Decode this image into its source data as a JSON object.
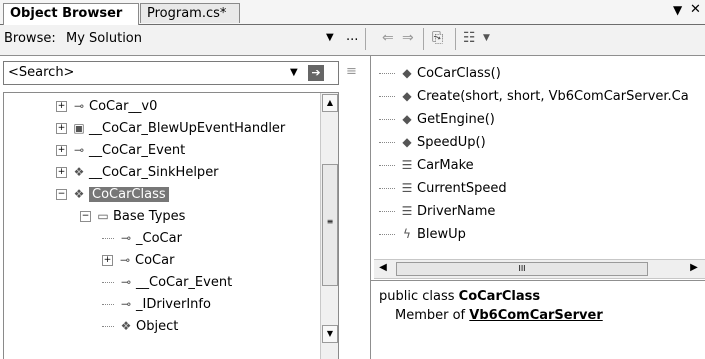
{
  "tabs": [
    {
      "label": "Object Browser",
      "active": true
    },
    {
      "label": "Program.cs*",
      "active": false
    }
  ],
  "tab_controls": {
    "menu_icon": "dropdown-arrow-icon",
    "close_icon": "close-icon"
  },
  "browse": {
    "label": "Browse:",
    "value": "My Solution",
    "more_label": "..."
  },
  "toolbar_icons": [
    "back-arrow-icon",
    "forward-arrow-icon",
    "add-reference-icon",
    "settings-icon"
  ],
  "search": {
    "placeholder": "<Search>"
  },
  "tree": [
    {
      "id": "n1",
      "label": "CoCar__v0",
      "icon": "interface-icon",
      "expander": "+"
    },
    {
      "id": "n2",
      "label": "__CoCar_BlewUpEventHandler",
      "icon": "delegate-icon",
      "expander": "+"
    },
    {
      "id": "n3",
      "label": "__CoCar_Event",
      "icon": "interface-icon",
      "expander": "+"
    },
    {
      "id": "n4",
      "label": "__CoCar_SinkHelper",
      "icon": "class-icon",
      "expander": "+"
    },
    {
      "id": "n5",
      "label": "CoCarClass",
      "icon": "class-icon",
      "expander": "−",
      "selected": true
    },
    {
      "id": "n6",
      "label": "Base Types",
      "icon": "folder-icon",
      "expander": "−"
    },
    {
      "id": "n7",
      "label": "_CoCar",
      "icon": "interface-icon",
      "expander": ""
    },
    {
      "id": "n8",
      "label": "CoCar",
      "icon": "interface-icon",
      "expander": "+"
    },
    {
      "id": "n9",
      "label": "__CoCar_Event",
      "icon": "interface-icon",
      "expander": ""
    },
    {
      "id": "n10",
      "label": "_IDriverInfo",
      "icon": "interface-icon",
      "expander": ""
    },
    {
      "id": "n11",
      "label": "Object",
      "icon": "class-icon",
      "expander": ""
    }
  ],
  "members": [
    {
      "label": "CoCarClass()",
      "icon": "method-icon"
    },
    {
      "label": "Create(short, short, Vb6ComCarServer.Ca",
      "icon": "method-icon"
    },
    {
      "label": "GetEngine()",
      "icon": "method-icon"
    },
    {
      "label": "SpeedUp()",
      "icon": "method-icon"
    },
    {
      "label": "CarMake",
      "icon": "property-icon"
    },
    {
      "label": "CurrentSpeed",
      "icon": "property-icon"
    },
    {
      "label": "DriverName",
      "icon": "property-icon"
    },
    {
      "label": "BlewUp",
      "icon": "event-icon"
    }
  ],
  "description": {
    "line1_prefix": "public class ",
    "line1_name": "CoCarClass",
    "line2_prefix": "Member of ",
    "line2_link": "Vb6ComCarServer"
  },
  "hscroll_grip": "III"
}
